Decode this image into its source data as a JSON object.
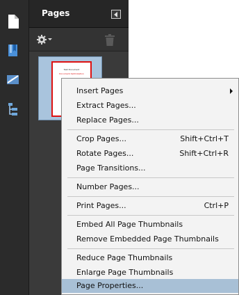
{
  "panel": {
    "title": "Pages",
    "thumbnail": {
      "line1": "Test Document",
      "line2": "Document Optimization"
    }
  },
  "menu": {
    "insert_pages": "Insert Pages",
    "extract_pages": "Extract Pages...",
    "replace_pages": "Replace Pages...",
    "crop_pages": "Crop Pages...",
    "crop_pages_shortcut": "Shift+Ctrl+T",
    "rotate_pages": "Rotate Pages...",
    "rotate_pages_shortcut": "Shift+Ctrl+R",
    "page_transitions": "Page Transitions...",
    "number_pages": "Number Pages...",
    "print_pages": "Print Pages...",
    "print_pages_shortcut": "Ctrl+P",
    "embed_all_thumbnails": "Embed All Page Thumbnails",
    "remove_embedded_thumbnails": "Remove Embedded Page Thumbnails",
    "reduce_thumbnails": "Reduce Page Thumbnails",
    "enlarge_thumbnails": "Enlarge Page Thumbnails",
    "page_properties": "Page Properties..."
  }
}
